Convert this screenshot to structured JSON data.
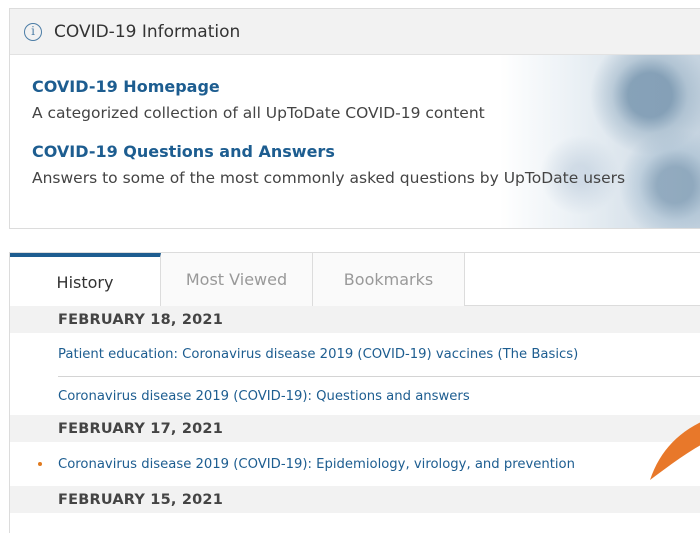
{
  "covid": {
    "header_title": "COVID-19 Information",
    "items": [
      {
        "title": "COVID-19 Homepage",
        "description": "A categorized collection of all UpToDate COVID-19 content"
      },
      {
        "title": "COVID-19 Questions and Answers",
        "description": "Answers to some of the most commonly asked questions by UpToDate users"
      }
    ]
  },
  "tabs": [
    {
      "label": "History",
      "active": true
    },
    {
      "label": "Most Viewed",
      "active": false
    },
    {
      "label": "Bookmarks",
      "active": false
    }
  ],
  "history": {
    "groups": [
      {
        "date": "FEBRUARY 18, 2021",
        "items": [
          "Patient education: Coronavirus disease 2019 (COVID-19) vaccines (The Basics)",
          "Coronavirus disease 2019 (COVID-19): Questions and answers"
        ]
      },
      {
        "date": "FEBRUARY 17, 2021",
        "items": [
          "Coronavirus disease 2019 (COVID-19): Epidemiology, virology, and prevention"
        ]
      },
      {
        "date": "FEBRUARY 15, 2021",
        "items": []
      }
    ]
  },
  "colors": {
    "link": "#1d5d90",
    "accent_tab": "#1d5d90",
    "bullet": "#e07a1f"
  }
}
